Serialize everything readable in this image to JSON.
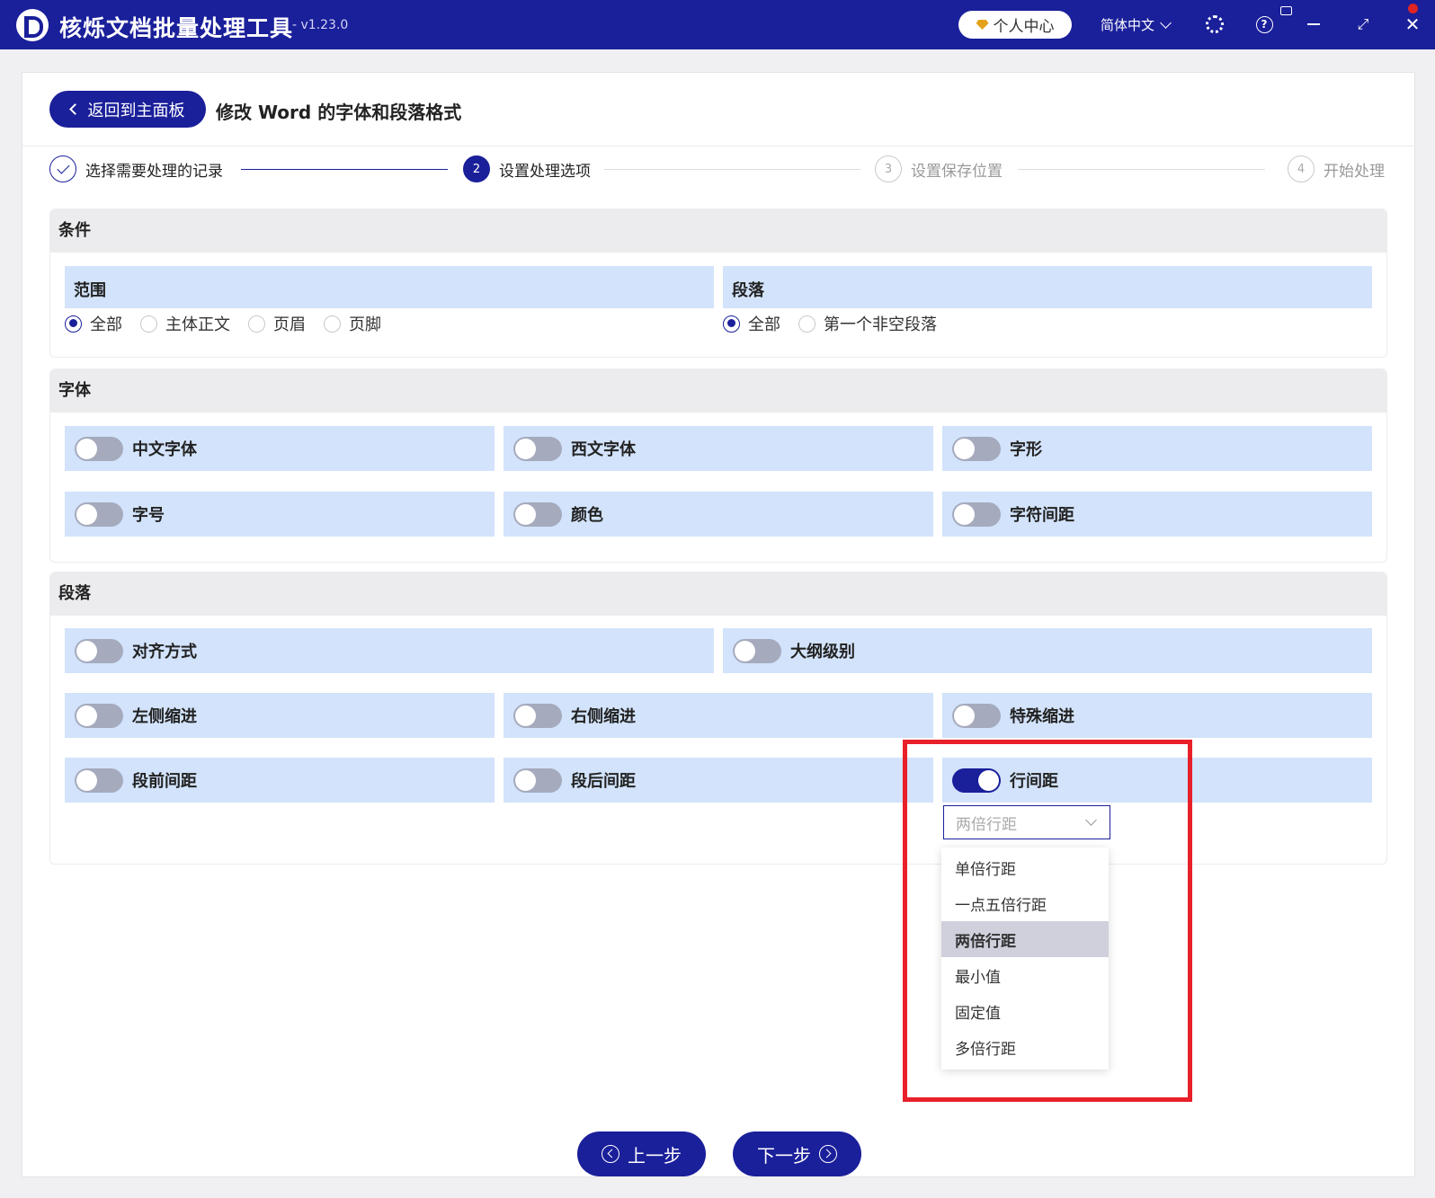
{
  "app": {
    "title": "核烁文档批量处理工具",
    "version": "- v1.23.0",
    "user_center": "个人中心",
    "language": "简体中文",
    "icons": [
      "logo-icon",
      "gem-icon",
      "gear-icon",
      "help-icon",
      "minimize-icon",
      "maximize-icon",
      "close-icon"
    ]
  },
  "colors": {
    "primary": "#1a1f9a",
    "panel": "#d2e3fb",
    "highlight": "#e8202a"
  },
  "header": {
    "back_label": "返回到主面板",
    "page_title": "修改 Word 的字体和段落格式"
  },
  "steps": [
    {
      "num": "",
      "label": "选择需要处理的记录",
      "state": "done"
    },
    {
      "num": "2",
      "label": "设置处理选项",
      "state": "active"
    },
    {
      "num": "3",
      "label": "设置保存位置",
      "state": "pending"
    },
    {
      "num": "4",
      "label": "开始处理",
      "state": "pending"
    }
  ],
  "conditions": {
    "title": "条件",
    "scope": {
      "label": "范围",
      "options": [
        "全部",
        "主体正文",
        "页眉",
        "页脚"
      ],
      "selected": "全部"
    },
    "paragraph": {
      "label": "段落",
      "options": [
        "全部",
        "第一个非空段落"
      ],
      "selected": "全部"
    }
  },
  "font": {
    "title": "字体",
    "toggles": [
      {
        "label": "中文字体",
        "on": false
      },
      {
        "label": "西文字体",
        "on": false
      },
      {
        "label": "字形",
        "on": false
      },
      {
        "label": "字号",
        "on": false
      },
      {
        "label": "颜色",
        "on": false
      },
      {
        "label": "字符间距",
        "on": false
      }
    ]
  },
  "paragraph": {
    "title": "段落",
    "toggles": [
      {
        "label": "对齐方式",
        "on": false
      },
      {
        "label": "大纲级别",
        "on": false
      },
      {
        "label": "左侧缩进",
        "on": false
      },
      {
        "label": "右侧缩进",
        "on": false
      },
      {
        "label": "特殊缩进",
        "on": false
      },
      {
        "label": "段前间距",
        "on": false
      },
      {
        "label": "段后间距",
        "on": false
      },
      {
        "label": "行间距",
        "on": true
      }
    ],
    "line_spacing": {
      "placeholder": "两倍行距",
      "options": [
        "单倍行距",
        "一点五倍行距",
        "两倍行距",
        "最小值",
        "固定值",
        "多倍行距"
      ],
      "selected": "两倍行距"
    }
  },
  "footer": {
    "prev_label": "上一步",
    "next_label": "下一步"
  }
}
